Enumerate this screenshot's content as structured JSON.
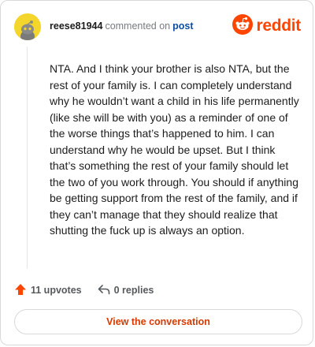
{
  "header": {
    "username": "reese81944",
    "action_text": "commented on",
    "post_link": "post",
    "brand_name": "reddit",
    "avatar_icon": "snoo-avatar-icon",
    "brand_icon": "reddit-logo-icon"
  },
  "comment": {
    "body": "NTA. And I think your brother is also NTA, but the rest of your family is. I can completely understand why he wouldn’t want a child in his life permanently (like she will be with you) as a reminder of one of the worse things that’s happened to him. I can understand why he would be upset. But I think that’s something the rest of your family should let the two of you work through. You should if anything be getting support from the rest of the family, and if they can’t manage that they should realize that shutting the fuck up is always an option."
  },
  "footer": {
    "upvotes_label": "11 upvotes",
    "replies_label": "0 replies",
    "upvote_icon": "upvote-arrow-icon",
    "reply_icon": "reply-arrow-icon"
  },
  "cta": {
    "label": "View the conversation"
  },
  "colors": {
    "brand": "#ff4500",
    "link": "#0e4ea3",
    "cta_text": "#d93900",
    "avatar_bg": "#f3d52c"
  }
}
